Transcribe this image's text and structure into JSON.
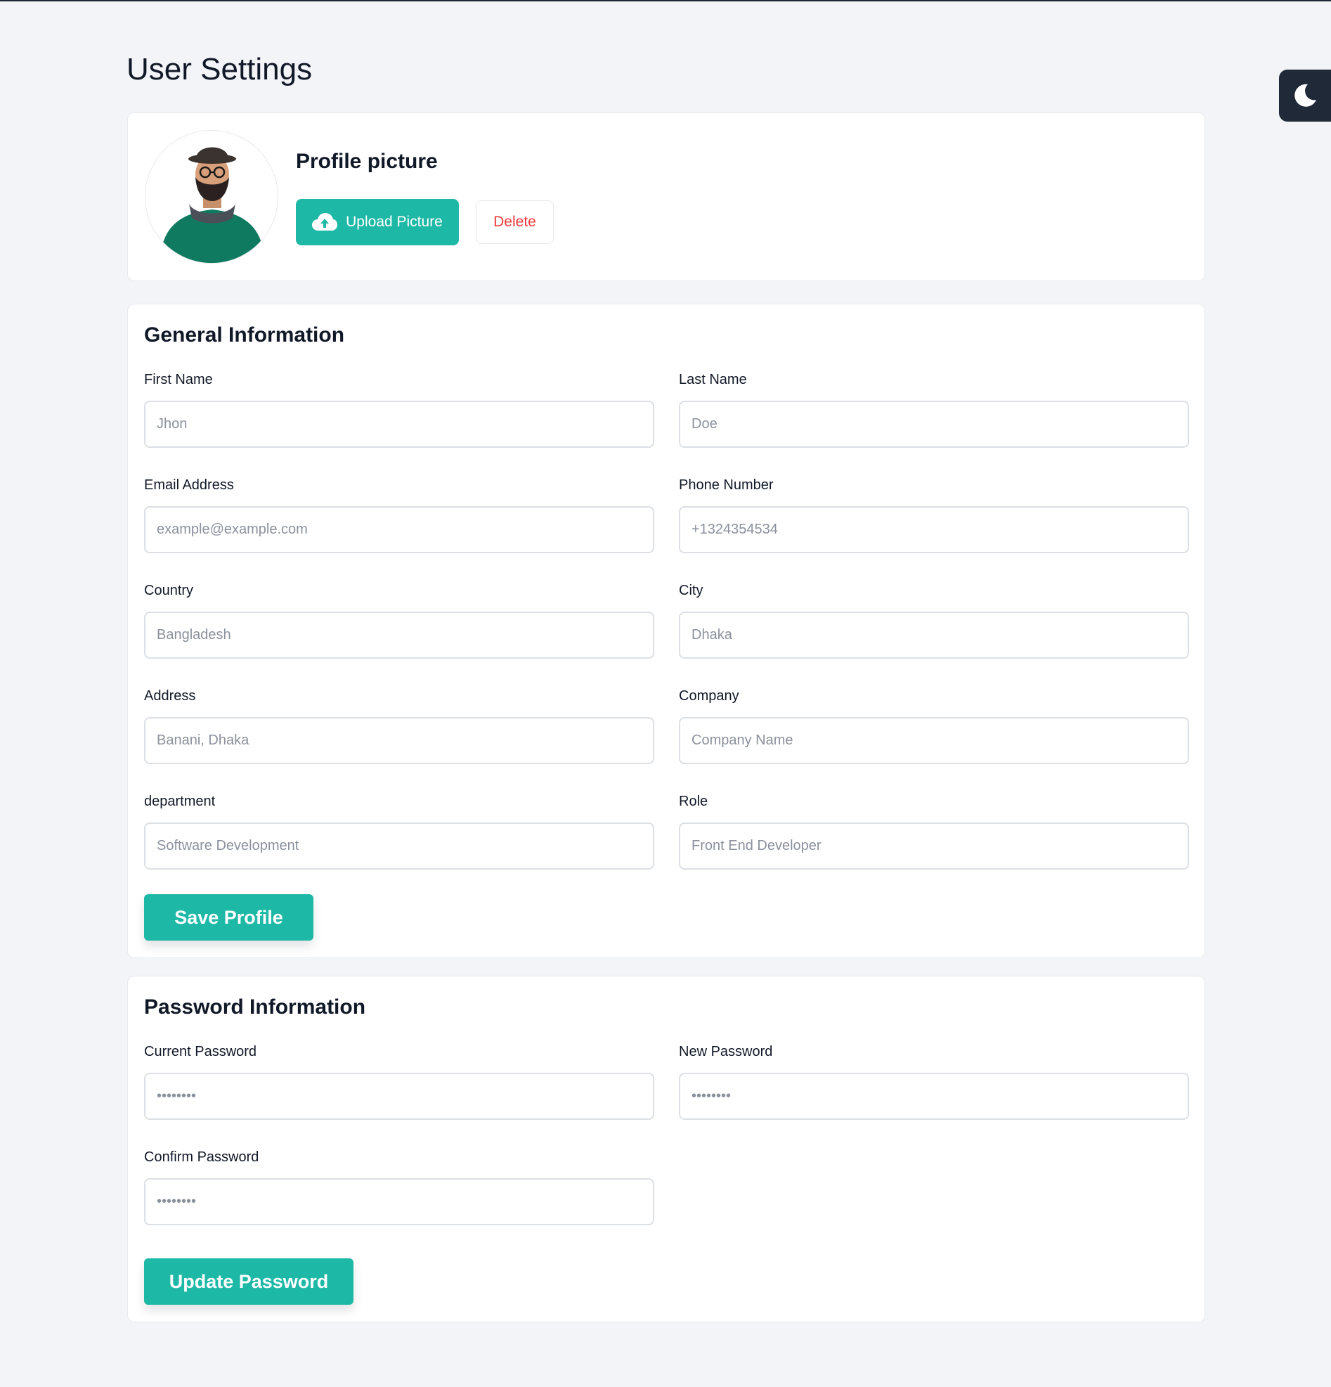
{
  "page": {
    "title": "User Settings"
  },
  "theme_toggle": {
    "icon": "moon-icon"
  },
  "profile": {
    "heading": "Profile picture",
    "upload_label": "Upload Picture",
    "upload_icon": "cloud-upload-icon",
    "delete_label": "Delete",
    "avatar_icon": "user-avatar"
  },
  "general": {
    "title": "General Information",
    "fields": [
      {
        "label": "First Name",
        "placeholder": "Jhon"
      },
      {
        "label": "Last Name",
        "placeholder": "Doe"
      },
      {
        "label": "Email Address",
        "placeholder": "example@example.com"
      },
      {
        "label": "Phone Number",
        "placeholder": "+1324354534"
      },
      {
        "label": "Country",
        "placeholder": "Bangladesh"
      },
      {
        "label": "City",
        "placeholder": "Dhaka"
      },
      {
        "label": "Address",
        "placeholder": "Banani, Dhaka"
      },
      {
        "label": "Company",
        "placeholder": "Company Name"
      },
      {
        "label": "department",
        "placeholder": "Software Development"
      },
      {
        "label": "Role",
        "placeholder": "Front End Developer"
      }
    ],
    "save_label": "Save Profile"
  },
  "password": {
    "title": "Password Information",
    "fields": [
      {
        "label": "Current Password",
        "placeholder": "••••••••"
      },
      {
        "label": "New Password",
        "placeholder": "••••••••"
      },
      {
        "label": "Confirm Password",
        "placeholder": "••••••••"
      }
    ],
    "update_label": "Update Password"
  },
  "colors": {
    "accent": "#1eb8a6",
    "danger": "#ef3b3b",
    "background": "#f3f4f7",
    "toggle": "#1f2937"
  }
}
